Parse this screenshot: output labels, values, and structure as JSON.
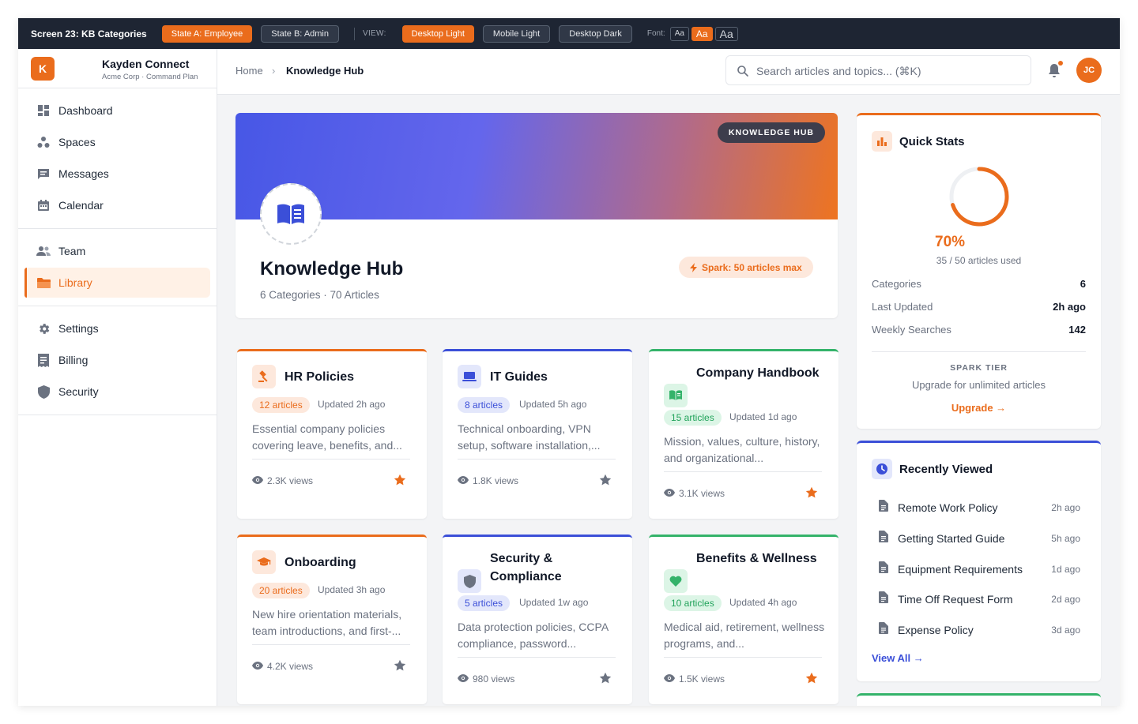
{
  "demo_bar": {
    "screen_title": "Screen 23: KB Categories",
    "states": [
      "State A: Employee",
      "State B: Admin"
    ],
    "view_label": "VIEW:",
    "views": [
      "Desktop Light",
      "Mobile Light",
      "Desktop Dark"
    ],
    "font_label": "Font:",
    "font_sizes": [
      "Aa",
      "Aa",
      "Aa"
    ]
  },
  "brand": {
    "logo_letter": "K",
    "name": "Kayden Connect",
    "subtitle": "Acme Corp · Command Plan"
  },
  "sidebar": {
    "groups": [
      [
        {
          "label": "Dashboard",
          "icon": "dashboard-icon"
        },
        {
          "label": "Spaces",
          "icon": "spaces-icon"
        },
        {
          "label": "Messages",
          "icon": "messages-icon"
        },
        {
          "label": "Calendar",
          "icon": "calendar-icon"
        }
      ],
      [
        {
          "label": "Team",
          "icon": "team-icon"
        },
        {
          "label": "Library",
          "icon": "folder-icon",
          "active": true
        }
      ],
      [
        {
          "label": "Settings",
          "icon": "gear-icon"
        },
        {
          "label": "Billing",
          "icon": "billing-icon"
        },
        {
          "label": "Security",
          "icon": "shield-icon"
        }
      ]
    ]
  },
  "header": {
    "breadcrumb": {
      "home": "Home",
      "separator": "›",
      "current": "Knowledge Hub"
    },
    "search_placeholder": "Search articles and topics... (⌘K)",
    "avatar_initials": "JC"
  },
  "hero": {
    "badge": "KNOWLEDGE HUB",
    "title": "Knowledge Hub",
    "meta": "6 Categories · 70 Articles",
    "spark": "Spark: 50 articles max"
  },
  "categories": [
    {
      "title": "HR Policies",
      "count": "12 articles",
      "updated": "Updated 2h ago",
      "desc": "Essential company policies covering leave, benefits, and...",
      "views": "2.3K views",
      "color": "orange",
      "starred": true,
      "icon": "gavel-icon"
    },
    {
      "title": "IT Guides",
      "count": "8 articles",
      "updated": "Updated 5h ago",
      "desc": "Technical onboarding, VPN setup, software installation,...",
      "views": "1.8K views",
      "color": "blue",
      "starred": false,
      "icon": "laptop-icon"
    },
    {
      "title": "Company Handbook",
      "count": "15 articles",
      "updated": "Updated 1d ago",
      "desc": "Mission, values, culture, history, and organizational...",
      "views": "3.1K views",
      "color": "green",
      "starred": true,
      "icon": "book-open-icon"
    },
    {
      "title": "Onboarding",
      "count": "20 articles",
      "updated": "Updated 3h ago",
      "desc": "New hire orientation materials, team introductions, and first-...",
      "views": "4.2K views",
      "color": "orange",
      "starred": false,
      "icon": "graduation-cap-icon"
    },
    {
      "title": "Security & Compliance",
      "count": "5 articles",
      "updated": "Updated 1w ago",
      "desc": "Data protection policies, CCPA compliance, password...",
      "views": "980 views",
      "color": "blue",
      "starred": false,
      "icon": "shield-icon"
    },
    {
      "title": "Benefits & Wellness",
      "count": "10 articles",
      "updated": "Updated 4h ago",
      "desc": "Medical aid, retirement, wellness programs, and...",
      "views": "1.5K views",
      "color": "green",
      "starred": true,
      "icon": "heart-icon"
    }
  ],
  "quick_stats": {
    "title": "Quick Stats",
    "percent_label": "70%",
    "percent_value": 0.7,
    "usage": "35 / 50 articles used",
    "rows": [
      {
        "label": "Categories",
        "value": "6"
      },
      {
        "label": "Last Updated",
        "value": "2h ago"
      },
      {
        "label": "Weekly Searches",
        "value": "142"
      }
    ],
    "tier_label": "SPARK TIER",
    "tier_text": "Upgrade for unlimited articles",
    "upgrade_label": "Upgrade →"
  },
  "recently_viewed": {
    "title": "Recently Viewed",
    "items": [
      {
        "title": "Remote Work Policy",
        "time": "2h ago"
      },
      {
        "title": "Getting Started Guide",
        "time": "5h ago"
      },
      {
        "title": "Equipment Requirements",
        "time": "1d ago"
      },
      {
        "title": "Time Off Request Form",
        "time": "2d ago"
      },
      {
        "title": "Expense Policy",
        "time": "3d ago"
      }
    ],
    "view_all": "View All →"
  },
  "colors": {
    "accent": "#ea6c1c",
    "blue": "#3b4fd8",
    "green": "#34b36a",
    "dark_bar": "#1e2533"
  }
}
